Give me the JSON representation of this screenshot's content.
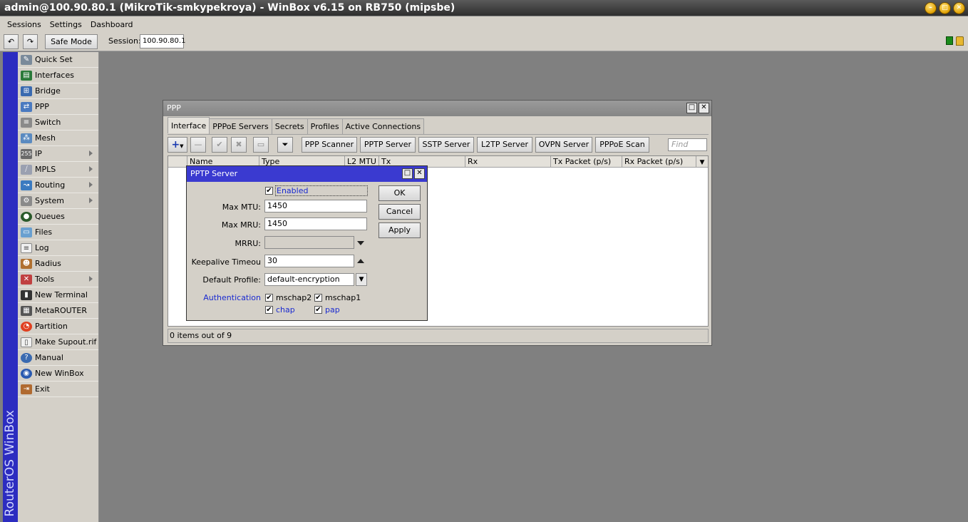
{
  "window": {
    "title": "admin@100.90.80.1 (MikroTik-smkypekroya) - WinBox v6.15 on RB750 (mipsbe)"
  },
  "menu": {
    "items": [
      "Sessions",
      "Settings",
      "Dashboard"
    ]
  },
  "toolbar": {
    "undo_icon": "undo-icon",
    "redo_icon": "redo-icon",
    "safe_mode_label": "Safe Mode",
    "session_label": "Session:",
    "session_value": "100.90.80.1"
  },
  "brand": {
    "text": "RouterOS WinBox",
    "color": "#2c2cc0"
  },
  "sidebar": {
    "items": [
      {
        "label": "Quick Set",
        "icon": "quick-set-icon"
      },
      {
        "label": "Interfaces",
        "icon": "interfaces-icon"
      },
      {
        "label": "Bridge",
        "icon": "bridge-icon"
      },
      {
        "label": "PPP",
        "icon": "ppp-icon"
      },
      {
        "label": "Switch",
        "icon": "switch-icon"
      },
      {
        "label": "Mesh",
        "icon": "mesh-icon"
      },
      {
        "label": "IP",
        "icon": "ip-icon"
      },
      {
        "label": "MPLS",
        "icon": "mpls-icon"
      },
      {
        "label": "Routing",
        "icon": "routing-icon"
      },
      {
        "label": "System",
        "icon": "system-icon"
      },
      {
        "label": "Queues",
        "icon": "queues-icon"
      },
      {
        "label": "Files",
        "icon": "files-icon"
      },
      {
        "label": "Log",
        "icon": "log-icon"
      },
      {
        "label": "Radius",
        "icon": "radius-icon"
      },
      {
        "label": "Tools",
        "icon": "tools-icon"
      },
      {
        "label": "New Terminal",
        "icon": "terminal-icon"
      },
      {
        "label": "MetaROUTER",
        "icon": "metarouter-icon"
      },
      {
        "label": "Partition",
        "icon": "partition-icon"
      },
      {
        "label": "Make Supout.rif",
        "icon": "supout-icon"
      },
      {
        "label": "Manual",
        "icon": "manual-icon"
      },
      {
        "label": "New WinBox",
        "icon": "winbox-icon"
      },
      {
        "label": "Exit",
        "icon": "exit-icon"
      }
    ]
  },
  "ppp": {
    "title": "PPP",
    "tabs": [
      "Interface",
      "PPPoE Servers",
      "Secrets",
      "Profiles",
      "Active Connections"
    ],
    "buttons": [
      "PPP Scanner",
      "PPTP Server",
      "SSTP Server",
      "L2TP Server",
      "OVPN Server",
      "PPPoE Scan"
    ],
    "find_placeholder": "Find",
    "columns": [
      "Name",
      "Type",
      "L2 MTU",
      "Tx",
      "Rx",
      "Tx Packet (p/s)",
      "Rx Packet (p/s)"
    ],
    "status": "0 items out of 9"
  },
  "pptp": {
    "title": "PPTP Server",
    "enabled_label": "Enabled",
    "enabled_checked": "✔",
    "max_mtu_label": "Max MTU:",
    "max_mtu_value": "1450",
    "max_mru_label": "Max MRU:",
    "max_mru_value": "1450",
    "mrru_label": "MRRU:",
    "mrru_value": "",
    "keepalive_label": "Keepalive Timeou",
    "keepalive_value": "30",
    "default_profile_label": "Default Profile:",
    "default_profile_value": "default-encryption",
    "auth_label": "Authentication",
    "auth": [
      "mschap2",
      "mschap1",
      "chap",
      "pap"
    ],
    "ok_label": "OK",
    "cancel_label": "Cancel",
    "apply_label": "Apply",
    "accent_color": "#3a3ad0"
  }
}
